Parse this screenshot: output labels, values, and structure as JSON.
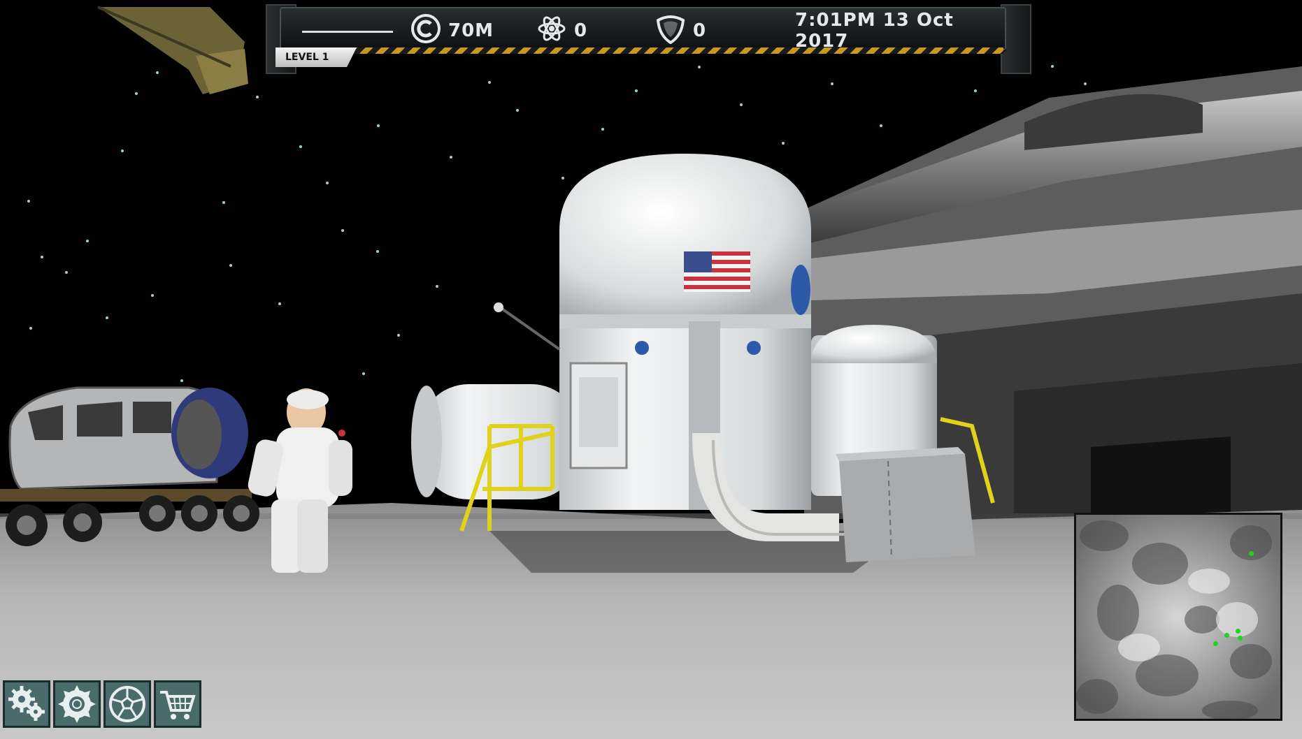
{
  "hud": {
    "credits": "70M",
    "atoms": "0",
    "shields": "0",
    "datetime": "7:01PM  13 Oct 2017",
    "level": "LEVEL 1"
  },
  "toolbar": {
    "items": [
      {
        "icon": "gears-icon"
      },
      {
        "icon": "sawblade-icon"
      },
      {
        "icon": "soccer-ball-icon"
      },
      {
        "icon": "cart-icon"
      }
    ]
  },
  "minimap": {
    "markers": 5
  },
  "colors": {
    "hud_text": "#e6e9ea",
    "hazard_yellow": "#c79a1e",
    "toolbar_button": "#4a6b6b",
    "minimap_marker": "#1fd21f"
  }
}
